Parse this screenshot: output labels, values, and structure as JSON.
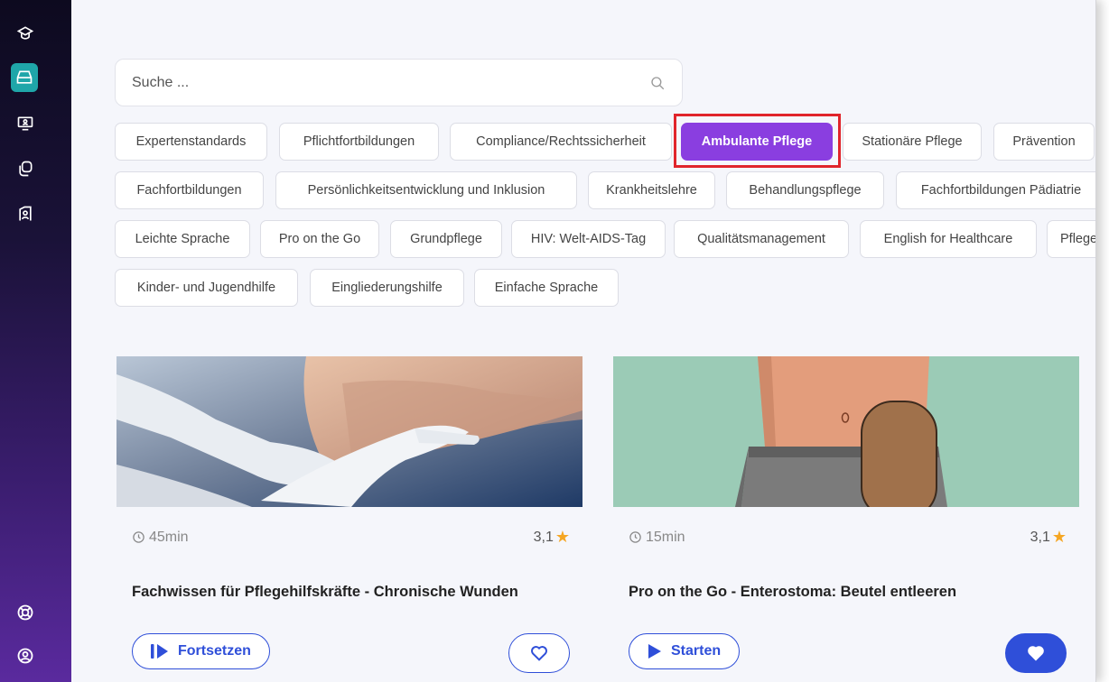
{
  "search": {
    "placeholder": "Suche ..."
  },
  "categories": {
    "row1": [
      "Expertenstandards",
      "Pflichtfortbildungen",
      "Compliance/Rechtssicherheit",
      "Ambulante Pflege",
      "Stationäre Pflege",
      "Prävention"
    ],
    "row2": [
      "Fachfortbildungen",
      "Persönlichkeitsentwicklung und Inklusion",
      "Krankheitslehre",
      "Behandlungspflege",
      "Fachfortbildungen Pädiatrie"
    ],
    "row3": [
      "Leichte Sprache",
      "Pro on the Go",
      "Grundpflege",
      "HIV: Welt-AIDS-Tag",
      "Qualitätsmanagement",
      "English for Healthcare",
      "Pflegep"
    ],
    "row4": [
      "Kinder- und Jugendhilfe",
      "Eingliederungshilfe",
      "Einfache Sprache"
    ],
    "active": "Ambulante Pflege"
  },
  "courses": [
    {
      "duration": "45min",
      "rating": "3,1",
      "title": "Fachwissen für Pflegehilfskräfte - Chronische Wunden",
      "action_label": "Fortsetzen",
      "favorite": false
    },
    {
      "duration": "15min",
      "rating": "3,1",
      "title": "Pro on the Go - Enterostoma: Beutel entleeren",
      "action_label": "Starten",
      "favorite": true
    }
  ],
  "icons": {
    "sidebar": [
      "graduation-cap-icon",
      "inbox-icon",
      "presentation-icon",
      "copy-icon",
      "user-settings-icon",
      "lifebuoy-icon",
      "user-circle-icon"
    ],
    "search": "search-icon",
    "duration": "clock-icon",
    "rating": "star-icon",
    "continue": "resume-icon",
    "start": "play-icon",
    "favorite": "heart-icon"
  },
  "colors": {
    "accent": "#2f4fd9",
    "active_chip": "#8a3ee0",
    "sidebar_active": "#1fa6a9",
    "highlight": "#e0252b",
    "star": "#f5a623"
  }
}
